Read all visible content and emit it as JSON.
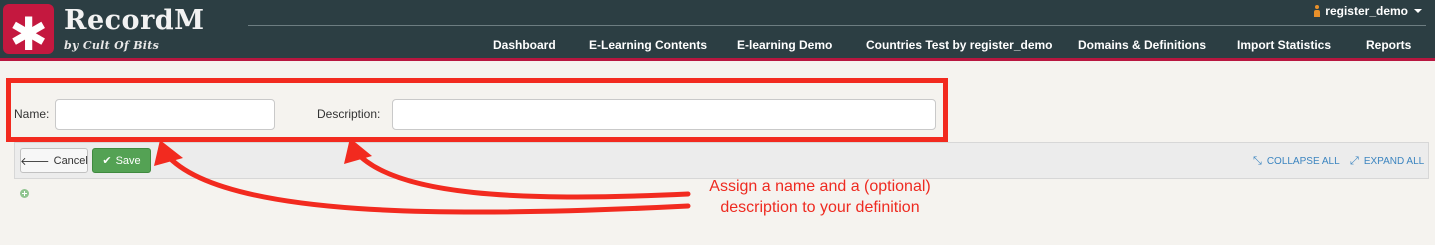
{
  "brand": {
    "logo_symbol": "✱",
    "title": "RecordM",
    "subtitle": "by Cult Of Bits"
  },
  "user": {
    "name": "register_demo",
    "icon": "person-icon"
  },
  "nav": {
    "items": [
      {
        "label": "Dashboard"
      },
      {
        "label": "E-Learning Contents"
      },
      {
        "label": "E-learning Demo"
      },
      {
        "label": "Countries Test by register_demo"
      },
      {
        "label": "Domains & Definitions"
      },
      {
        "label": "Import Statistics"
      },
      {
        "label": "Reports"
      }
    ]
  },
  "form": {
    "name_label": "Name:",
    "name_value": "",
    "description_label": "Description:",
    "description_value": ""
  },
  "toolbar": {
    "cancel_label": "Cancel",
    "save_label": "Save",
    "collapse_label": "COLLAPSE ALL",
    "expand_label": "EXPAND ALL"
  },
  "annotation": {
    "line1": "Assign a name and a (optional)",
    "line2": "description to your definition"
  },
  "colors": {
    "header_bg": "#2c3e43",
    "brand_accent": "#c4183f",
    "save_green": "#54a254",
    "link_blue": "#3c85c0",
    "annotation_red": "#ee2a20"
  }
}
